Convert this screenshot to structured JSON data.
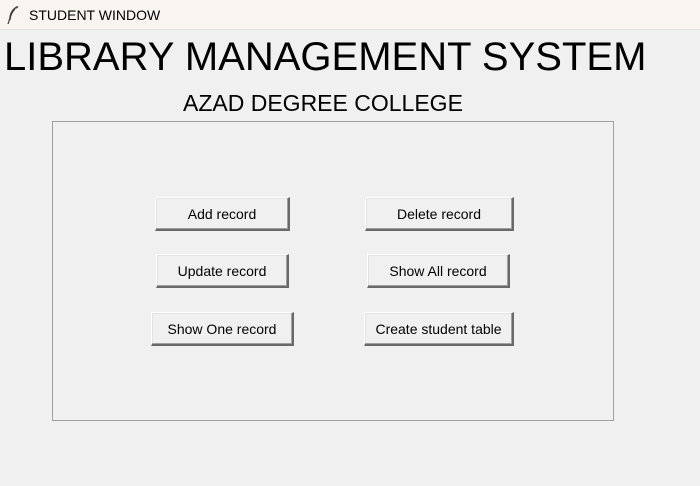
{
  "window": {
    "title": "STUDENT WINDOW",
    "icon": "feather-icon"
  },
  "header": {
    "app_title": "LIBRARY MANAGEMENT SYSTEM",
    "college_name": "AZAD DEGREE COLLEGE"
  },
  "buttons": {
    "add": "Add record",
    "delete": "Delete record",
    "update": "Update record",
    "show_all": "Show All record",
    "show_one": "Show One record",
    "create_table": "Create student table"
  },
  "colors": {
    "background": "#f0f0f0",
    "titlebar": "#f9f4f0",
    "frame_border": "#a0a0a0"
  }
}
